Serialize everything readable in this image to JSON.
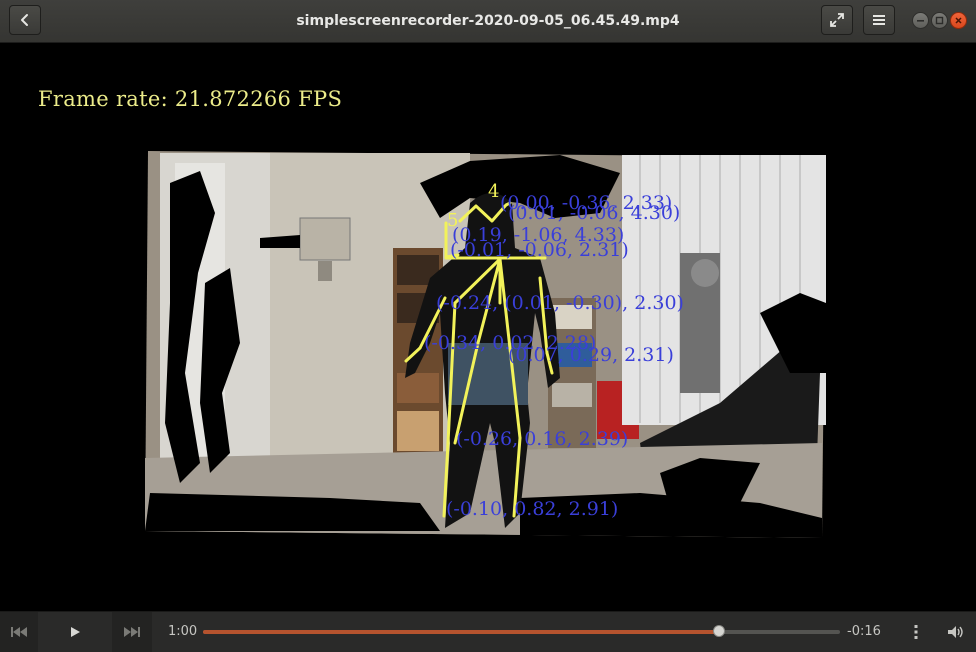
{
  "window": {
    "title": "simplescreenrecorder-2020-09-05_06.45.49.mp4",
    "back_icon": "chevron-left-icon",
    "fullscreen_icon": "expand-icon",
    "menu_icon": "hamburger-menu-icon"
  },
  "video": {
    "overlay_text": "Frame rate: 21.872266 FPS",
    "joint_labels": [
      {
        "text": "4"
      },
      {
        "text": "(0.00,  -0.36,  2.33)"
      },
      {
        "text": "(0.01,  -0.06,  4.30)"
      },
      {
        "text": "5"
      },
      {
        "text": "(0.19,  -1.06,  4.33)"
      },
      {
        "text": "(-0.01,  -0.06,  2.31)"
      },
      {
        "text": "(-0.24,  (0.01,  -0.30),  2.30)"
      },
      {
        "text": "(-0.34,  0.02,  2.28)"
      },
      {
        "text": "(0.07,  0.29,  2.31)"
      },
      {
        "text": "(-0.26,  0.16,  2.39)"
      },
      {
        "text": "(-0.10,  0.82,  2.91)"
      }
    ],
    "accent_skeleton": "#f2f25a",
    "accent_labels": "#3a3fd9"
  },
  "player": {
    "elapsed": "1:00",
    "remaining": "-0:16",
    "progress": 0.81,
    "accent": "#b5532e",
    "prev_icon": "skip-back-icon",
    "play_icon": "play-icon",
    "next_icon": "skip-forward-icon",
    "options_icon": "vertical-dots-icon",
    "volume_icon": "volume-icon"
  }
}
